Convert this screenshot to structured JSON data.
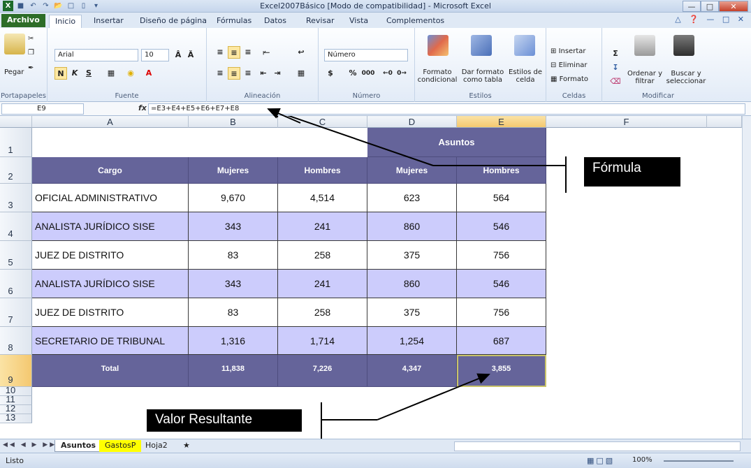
{
  "window": {
    "title": "Excel2007Básico  [Modo de compatibilidad]  -  Microsoft Excel"
  },
  "tabs": [
    "Archivo",
    "Inicio",
    "Insertar",
    "Diseño de página",
    "Fórmulas",
    "Datos",
    "Revisar",
    "Vista",
    "Complementos"
  ],
  "ribbon": {
    "clipboard": {
      "paste": "Pegar",
      "label": "Portapapeles"
    },
    "font": {
      "name": "Arial",
      "size": "10",
      "bold": "N",
      "italic": "K",
      "underline": "S",
      "label": "Fuente"
    },
    "alignment": {
      "label": "Alineación"
    },
    "number": {
      "format": "Número",
      "currency": "$",
      "percent": "%",
      "thousands": "000",
      "label": "Número"
    },
    "styles": {
      "conditional": "Formato condicional",
      "table": "Dar formato como tabla",
      "cell_styles": "Estilos de celda",
      "label": "Estilos"
    },
    "cells": {
      "insert": "Insertar",
      "delete": "Eliminar",
      "format": "Formato",
      "label": "Celdas"
    },
    "editing": {
      "sigma": "Σ",
      "sort": "Ordenar y filtrar",
      "find": "Buscar y seleccionar",
      "label": "Modificar"
    }
  },
  "formula_bar": {
    "name_box": "E9",
    "fx": "fx",
    "formula": "=E3+E4+E5+E6+E7+E8"
  },
  "grid": {
    "columns": [
      "A",
      "B",
      "C",
      "D",
      "E",
      "F"
    ],
    "rows": [
      "1",
      "2",
      "3",
      "4",
      "5",
      "6",
      "7",
      "8",
      "9",
      "10",
      "11",
      "12",
      "13"
    ],
    "group_header": "Asuntos",
    "headers": [
      "Cargo",
      "Mujeres",
      "Hombres",
      "Mujeres",
      "Hombres"
    ],
    "data": [
      [
        "OFICIAL ADMINISTRATIVO",
        "9,670",
        "4,514",
        "623",
        "564"
      ],
      [
        "ANALISTA JURÍDICO SISE",
        "343",
        "241",
        "860",
        "546"
      ],
      [
        "JUEZ DE DISTRITO",
        "83",
        "258",
        "375",
        "756"
      ],
      [
        "ANALISTA JURÍDICO SISE",
        "343",
        "241",
        "860",
        "546"
      ],
      [
        "JUEZ DE DISTRITO",
        "83",
        "258",
        "375",
        "756"
      ],
      [
        "SECRETARIO DE TRIBUNAL",
        "1,316",
        "1,714",
        "1,254",
        "687"
      ]
    ],
    "total": [
      "Total",
      "11,838",
      "7,226",
      "4,347",
      "3,855"
    ]
  },
  "annotations": {
    "formula": "Fórmula",
    "result": "Valor Resultante"
  },
  "sheets": [
    "Asuntos",
    "GastosP",
    "Hoja2"
  ],
  "status": {
    "ready": "Listo",
    "zoom": "100%"
  },
  "colors": {
    "header_fill": "#65649a",
    "alt_row": "#ccccfc",
    "file_tab": "#2d6d28",
    "gastos_tab": "#ffff00"
  }
}
